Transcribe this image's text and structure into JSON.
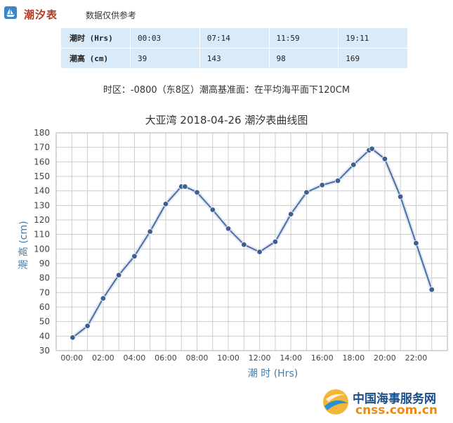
{
  "header": {
    "title": "潮汐表",
    "note": "数据仅供参考"
  },
  "table": {
    "time_label": "潮时 (Hrs)",
    "height_label": "潮高 (cm)",
    "times": [
      "00:03",
      "07:14",
      "11:59",
      "19:11"
    ],
    "heights": [
      "39",
      "143",
      "98",
      "169"
    ]
  },
  "zone_text": "时区：-0800（东8区）潮高基准面：在平均海平面下120CM",
  "brand": {
    "cn": "中国海事服务网",
    "en": "cnss.com.cn"
  },
  "colors": {
    "line": "#4a6fa5",
    "point": "#3f5f93",
    "grid": "#cccccc",
    "axis_title": "#3b7fb5"
  },
  "chart_data": {
    "type": "line",
    "title": "大亚湾 2018-04-26 潮汐表曲线图",
    "xlabel": "潮 时 (Hrs)",
    "ylabel": "潮 高 (cm)",
    "ylim": [
      30,
      180
    ],
    "xlim": [
      -1,
      24
    ],
    "yticks": [
      30,
      40,
      50,
      60,
      70,
      80,
      90,
      100,
      110,
      120,
      130,
      140,
      150,
      160,
      170,
      180
    ],
    "xticks": [
      {
        "v": 0,
        "label": "00:00"
      },
      {
        "v": 2,
        "label": "02:00"
      },
      {
        "v": 4,
        "label": "04:00"
      },
      {
        "v": 6,
        "label": "06:00"
      },
      {
        "v": 8,
        "label": "08:00"
      },
      {
        "v": 10,
        "label": "10:00"
      },
      {
        "v": 12,
        "label": "12:00"
      },
      {
        "v": 14,
        "label": "14:00"
      },
      {
        "v": 16,
        "label": "16:00"
      },
      {
        "v": 18,
        "label": "18:00"
      },
      {
        "v": 20,
        "label": "20:00"
      },
      {
        "v": 22,
        "label": "22:00"
      }
    ],
    "grid": true,
    "series": [
      {
        "x": [
          0.05,
          1,
          2,
          3,
          4,
          5,
          6,
          7,
          7.23,
          8,
          9,
          10,
          11,
          12,
          13,
          14,
          15,
          16,
          17,
          18,
          19,
          19.18,
          20,
          21,
          22,
          23
        ],
        "y": [
          39,
          47,
          66,
          82,
          95,
          112,
          131,
          143,
          143,
          139,
          127,
          114,
          103,
          98,
          105,
          124,
          139,
          144,
          147,
          158,
          168,
          169,
          162,
          136,
          104,
          72
        ]
      }
    ]
  }
}
